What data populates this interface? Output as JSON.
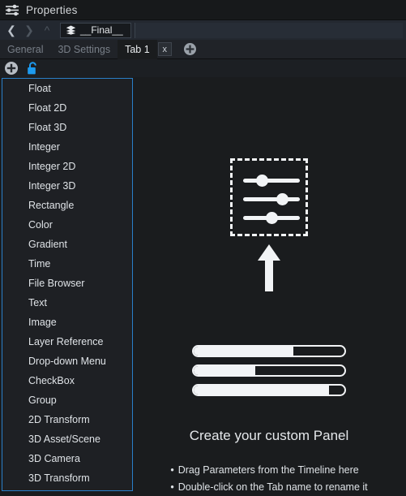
{
  "window": {
    "title": "Properties",
    "title_icon": "sliders-icon"
  },
  "nav": {
    "back_icon": "chevron-left-icon",
    "forward_icon": "chevron-right-icon",
    "up_icon": "chevron-up-icon",
    "breadcrumb_icon": "layers-icon",
    "breadcrumb_label": "__Final__"
  },
  "tabs": {
    "items": [
      {
        "label": "General",
        "active": false
      },
      {
        "label": "3D Settings",
        "active": false
      },
      {
        "label": "Tab 1",
        "active": true
      }
    ],
    "close_label": "x",
    "close_icon": "close-icon",
    "add_icon": "plus-circle-icon"
  },
  "toolbar": {
    "add_icon": "plus-circle-icon",
    "lock_icon": "unlock-icon",
    "lock_color": "#1d9bf0"
  },
  "menu": {
    "items": [
      {
        "label": "Float"
      },
      {
        "label": "Float 2D"
      },
      {
        "label": "Float 3D"
      },
      {
        "label": "Integer"
      },
      {
        "label": "Integer 2D"
      },
      {
        "label": "Integer 3D"
      },
      {
        "label": "Rectangle"
      },
      {
        "label": "Color"
      },
      {
        "label": "Gradient"
      },
      {
        "label": "Time"
      },
      {
        "label": "File Browser"
      },
      {
        "label": "Text"
      },
      {
        "label": "Image"
      },
      {
        "label": "Layer Reference"
      },
      {
        "label": "Drop-down Menu"
      },
      {
        "label": "CheckBox"
      },
      {
        "label": "Group"
      },
      {
        "label": "2D Transform"
      },
      {
        "label": "3D Asset/Scene"
      },
      {
        "label": "3D Camera"
      },
      {
        "label": "3D Transform"
      }
    ],
    "border_color": "#2a7fc9"
  },
  "empty_state": {
    "panel_icon": "panel-sliders-icon",
    "arrow_icon": "arrow-up-icon",
    "sliders": [
      {
        "position_pct": 32
      },
      {
        "position_pct": 68
      },
      {
        "position_pct": 50
      }
    ],
    "bars": [
      {
        "fill_pct": 66
      },
      {
        "fill_pct": 41
      },
      {
        "fill_pct": 90
      }
    ],
    "title": "Create your custom Panel",
    "hints": [
      "Drag Parameters from the Timeline here",
      "Double-click on the Tab name to rename it"
    ]
  },
  "colors": {
    "background": "#1a1c1e",
    "titlebar": "#17191b",
    "navrow": "#232830",
    "tabrow": "#202328",
    "accent": "#2a7fc9",
    "text": "#dfe3e7",
    "text_dim": "#787f88",
    "art": "#f2f4f6"
  }
}
